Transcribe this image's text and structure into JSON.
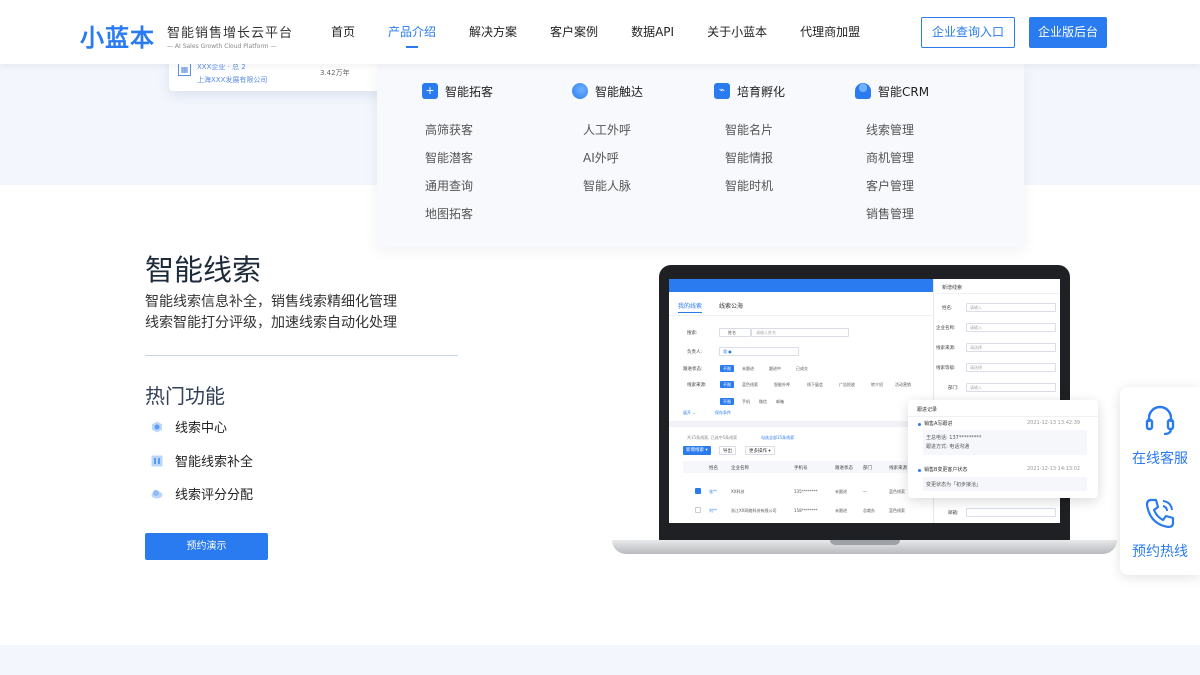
{
  "header": {
    "logo_mark": "小蓝本",
    "logo_cn": "智能销售增长云平台",
    "logo_en": "— AI Sales Growth Cloud Platform —",
    "nav": [
      "首页",
      "产品介绍",
      "解决方案",
      "客户案例",
      "数据API",
      "关于小蓝本",
      "代理商加盟"
    ],
    "active_nav": "产品介绍",
    "btn_query": "企业查询入口",
    "btn_admin": "企业版后台"
  },
  "hero_card": {
    "company": "XXX企业 · 总 2",
    "subtitle": "上海XXX发展有限公司",
    "amount": "3.42万年"
  },
  "dropdown": {
    "columns": [
      {
        "title": "智能拓客",
        "items": [
          "高筛获客",
          "智能潜客",
          "通用查询",
          "地图拓客"
        ]
      },
      {
        "title": "智能触达",
        "items": [
          "人工外呼",
          "AI外呼",
          "智能人脉"
        ]
      },
      {
        "title": "培育孵化",
        "items": [
          "智能名片",
          "智能情报",
          "智能时机"
        ]
      },
      {
        "title": "智能CRM",
        "items": [
          "线索管理",
          "商机管理",
          "客户管理",
          "销售管理"
        ]
      }
    ]
  },
  "main": {
    "title": "智能线索",
    "desc1": "智能线索信息补全，销售线索精细化管理",
    "desc2": "线索智能打分评级，加速线索自动化处理",
    "hot_title": "热门功能",
    "features": [
      "线索中心",
      "智能线索补全",
      "线索评分分配"
    ],
    "demo_button": "预约演示"
  },
  "screen": {
    "tab_mine": "我的线索",
    "tab_pool": "线索公海",
    "lbl_search": "搜索:",
    "opt_name": "姓名",
    "ph_input": "请输入姓名",
    "lbl_owner": "负责人:",
    "owner_chip": "我 ●",
    "lbl_status": "跟进状态:",
    "status_opts": [
      "不限",
      "未跟进",
      "跟进中",
      "已成交"
    ],
    "lbl_source": "线索来源:",
    "source_opts": [
      "不限",
      "蓝色线索",
      "智能外呼",
      "线下展会",
      "广告投放",
      "转介绍",
      "活动营销"
    ],
    "sub_opts": [
      "不限",
      "手机",
      "微信",
      "邮箱"
    ],
    "filter_link": "展开 ⌄",
    "save_filter": "保存条件",
    "selected_info": "共15条线索, 已选中5条线索",
    "select_all": "勾选全部15条线索",
    "btn_new": "新增线索 ▾",
    "btn_export": "导出",
    "btn_more": "更多操作 ▾",
    "cols": [
      "姓名",
      "企业名称",
      "手机号",
      "跟进状态",
      "部门",
      "线索来源"
    ],
    "rows": [
      [
        "张**",
        "XX科技",
        "135********",
        "未跟进",
        "—",
        "蓝色线索"
      ],
      [
        "刘**",
        "浙江XX网络科技有限公司",
        "158********",
        "未跟进",
        "总裁办",
        "蓝色线索"
      ]
    ],
    "panel_title": "新增线索",
    "panel_fields": [
      "姓名:",
      "企业名称:",
      "线索来源:",
      "线索等级:",
      "部门:"
    ],
    "panel_ph": [
      "请输入",
      "请输入",
      "请选择",
      "请选择",
      "请输入"
    ],
    "panel_email": "邮箱:"
  },
  "popup": {
    "title": "跟进记录",
    "r1_title": "销售A写跟进",
    "r1_time": "2021-12-13 13:42:39",
    "r1_line1": "王总电话: 137*********",
    "r1_line2": "跟进方式: 电话沟通",
    "r2_title": "销售B变更客户状态",
    "r2_time": "2021-12-13 14:13:02",
    "r2_line1": "变更状态为「初步接洽」"
  },
  "float": {
    "service": "在线客服",
    "hotline": "预约热线"
  },
  "colors": {
    "accent": "#2a7bf0",
    "band": "#f3f6fc"
  },
  "icons": [
    "headset-icon",
    "phone-icon",
    "lead-center-icon",
    "lead-complete-icon",
    "lead-score-icon"
  ]
}
